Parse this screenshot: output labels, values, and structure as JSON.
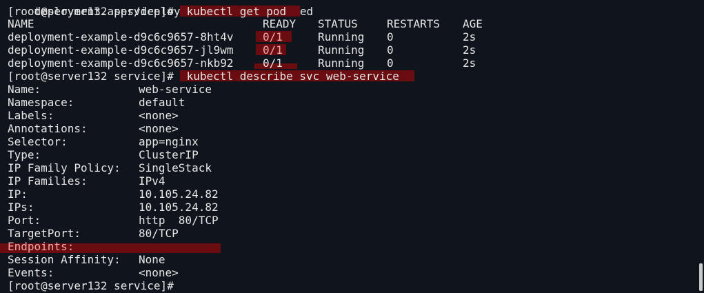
{
  "terminal": {
    "line0": "deployment.apps/deployment-example created",
    "cmd1": {
      "prompt": "[root@server132 service]#",
      "command": " kubectl get pod"
    },
    "pods": {
      "headers": {
        "name": "NAME",
        "ready": "READY",
        "status": "STATUS",
        "restarts": "RESTARTS",
        "age": "AGE"
      },
      "rows": [
        {
          "name": "deployment-example-d9c6c9657-8ht4v",
          "ready": "0/1",
          "status": "Running",
          "restarts": "0",
          "age": "2s"
        },
        {
          "name": "deployment-example-d9c6c9657-jl9wm",
          "ready": "0/1",
          "status": "Running",
          "restarts": "0",
          "age": "2s"
        },
        {
          "name": "deployment-example-d9c6c9657-nkb92",
          "ready": "0/1",
          "status": "Running",
          "restarts": "0",
          "age": "2s"
        }
      ]
    },
    "cmd2": {
      "prompt": "[root@server132 service]#",
      "command": " kubectl describe svc web-service"
    },
    "describe": [
      {
        "key": "Name:",
        "value": "web-service"
      },
      {
        "key": "Namespace:",
        "value": "default"
      },
      {
        "key": "Labels:",
        "value": "<none>"
      },
      {
        "key": "Annotations:",
        "value": "<none>"
      },
      {
        "key": "Selector:",
        "value": "app=nginx"
      },
      {
        "key": "Type:",
        "value": "ClusterIP"
      },
      {
        "key": "IP Family Policy:",
        "value": "SingleStack"
      },
      {
        "key": "IP Families:",
        "value": "IPv4"
      },
      {
        "key": "IP:",
        "value": "10.105.24.82"
      },
      {
        "key": "IPs:",
        "value": "10.105.24.82"
      },
      {
        "key": "Port:",
        "value": "http  80/TCP"
      },
      {
        "key": "TargetPort:",
        "value": "80/TCP"
      },
      {
        "key": "Endpoints:",
        "value": ""
      },
      {
        "key": "Session Affinity:",
        "value": "None"
      },
      {
        "key": "Events:",
        "value": "<none>"
      }
    ],
    "final_prompt": "[root@server132 service]#"
  },
  "colors": {
    "background": "#10151d",
    "text": "#e6e6e6",
    "highlight": "#6a0c10",
    "highlight_text": "#f0aaaa"
  }
}
